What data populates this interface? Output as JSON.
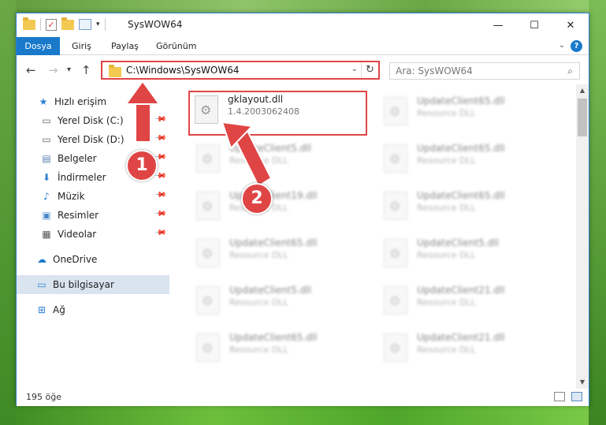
{
  "window": {
    "title": "SysWOW64",
    "minimize_glyph": "—",
    "maximize_glyph": "☐",
    "close_glyph": "✕"
  },
  "ribbon": {
    "tabs": [
      "Dosya",
      "Giriş",
      "Paylaş",
      "Görünüm"
    ],
    "help_glyph": "?"
  },
  "nav": {
    "address": "C:\\Windows\\SysWOW64",
    "search_placeholder": "Ara: SysWOW64"
  },
  "sidebar": {
    "items": [
      {
        "label": "Hızlı erişim",
        "icon": "star-icon",
        "pinned": false
      },
      {
        "label": "Yerel Disk (C:)",
        "icon": "drive-icon",
        "pinned": true
      },
      {
        "label": "Yerel Disk (D:)",
        "icon": "drive-icon",
        "pinned": true
      },
      {
        "label": "Belgeler",
        "icon": "documents-icon",
        "pinned": true
      },
      {
        "label": "İndirmeler",
        "icon": "download-icon",
        "pinned": true
      },
      {
        "label": "Müzik",
        "icon": "music-icon",
        "pinned": true
      },
      {
        "label": "Resimler",
        "icon": "pictures-icon",
        "pinned": true
      },
      {
        "label": "Videolar",
        "icon": "videos-icon",
        "pinned": true
      },
      {
        "label": "OneDrive",
        "icon": "cloud-icon",
        "pinned": false
      },
      {
        "label": "Bu bilgisayar",
        "icon": "computer-icon",
        "pinned": false,
        "selected": true
      },
      {
        "label": "Ağ",
        "icon": "network-icon",
        "pinned": false
      }
    ]
  },
  "files": {
    "selected": {
      "name": "gklayout.dll",
      "type": "1.4.2003062408"
    },
    "left_column": [
      {
        "name": "UpdateClient5.dll",
        "type": "Resource DLL"
      },
      {
        "name": "UpdateClient19.dll",
        "type": "Resource DLL"
      },
      {
        "name": "UpdateClient65.dll",
        "type": "Resource DLL"
      },
      {
        "name": "UpdateClient5.dll",
        "type": "Resource DLL"
      },
      {
        "name": "UpdateClient65.dll",
        "type": "Resource DLL"
      }
    ],
    "right_column": [
      {
        "name": "UpdateClient65.dll",
        "type": "Resource DLL"
      },
      {
        "name": "UpdateClient65.dll",
        "type": "Resource DLL"
      },
      {
        "name": "UpdateClient65.dll",
        "type": "Resource DLL"
      },
      {
        "name": "UpdateClient5.dll",
        "type": "Resource DLL"
      },
      {
        "name": "UpdateClient21.dll",
        "type": "Resource DLL"
      },
      {
        "name": "UpdateClient21.dll",
        "type": "Resource DLL"
      }
    ]
  },
  "status": {
    "count": "195 öğe"
  },
  "annotations": {
    "step1": "1",
    "step2": "2",
    "color": "#e04545"
  }
}
